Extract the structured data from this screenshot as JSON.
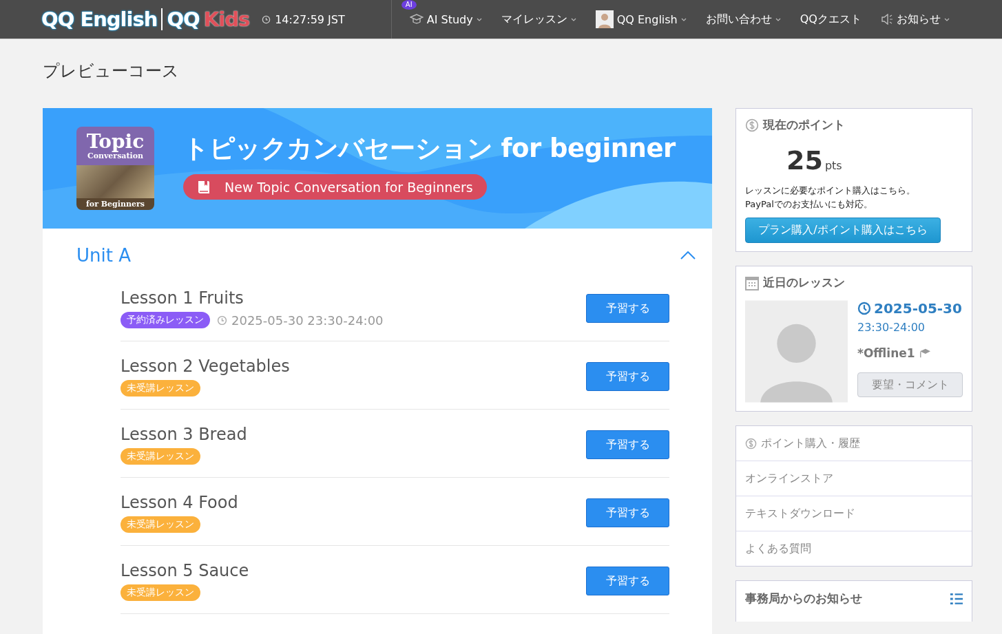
{
  "header": {
    "logo": {
      "brand": "QQ English",
      "kids_prefix": "QQ",
      "kids_word": "Kids"
    },
    "clock": "14:27:59 JST",
    "nav": [
      {
        "kind": "ai",
        "label": "AI Study",
        "badge": "AI",
        "dropdown": true
      },
      {
        "kind": "plain",
        "label": "マイレッスン",
        "dropdown": true
      },
      {
        "kind": "user",
        "label": "QQ English",
        "dropdown": true
      },
      {
        "kind": "plain",
        "label": "お問い合わせ",
        "dropdown": true
      },
      {
        "kind": "plain",
        "label": "QQクエスト",
        "dropdown": false
      },
      {
        "kind": "notice",
        "label": "お知らせ",
        "dropdown": true
      }
    ]
  },
  "page_title": "プレビューコース",
  "course": {
    "title": "トピックカンバセーション for beginner",
    "subtitle": "New Topic Conversation for Beginners",
    "thumbnail": {
      "title": "Topic",
      "subtitle": "Conversation",
      "footer": "for Beginners"
    },
    "unit": {
      "title": "Unit A",
      "expanded": true,
      "lessons": [
        {
          "title": "Lesson 1 Fruits",
          "status": "予約済みレッスン",
          "color": "#8b5cf6",
          "time": "2025-05-30 23:30-24:00",
          "button": "予習する"
        },
        {
          "title": "Lesson 2 Vegetables",
          "status": "未受講レッスン",
          "color": "#fbb13c",
          "button": "予習する"
        },
        {
          "title": "Lesson 3 Bread",
          "status": "未受講レッスン",
          "color": "#fbb13c",
          "button": "予習する"
        },
        {
          "title": "Lesson 4 Food",
          "status": "未受講レッスン",
          "color": "#fbb13c",
          "button": "予習する"
        },
        {
          "title": "Lesson 5 Sauce",
          "status": "未受講レッスン",
          "color": "#fbb13c",
          "button": "予習する"
        }
      ]
    }
  },
  "sidebar": {
    "points": {
      "title": "現在のポイント",
      "value": "25",
      "unit": "pts",
      "note_1": "レッスンに必要なポイント購入はこちら。",
      "note_2": "PayPalでのお支払いにも対応。",
      "button": "プラン購入/ポイント購入はこちら"
    },
    "upcoming": {
      "title": "近日のレッスン",
      "date": "2025-05-30",
      "time": "23:30-24:00",
      "teacher": "*Offline1",
      "button": "要望・コメント"
    },
    "links": [
      {
        "kind": "points",
        "label": "ポイント購入・履歴"
      },
      {
        "kind": "plain",
        "label": "オンラインストア"
      },
      {
        "kind": "plain",
        "label": "テキストダウンロード"
      },
      {
        "kind": "plain",
        "label": "よくある質問"
      }
    ],
    "news": {
      "title": "事務局からのお知らせ"
    }
  }
}
